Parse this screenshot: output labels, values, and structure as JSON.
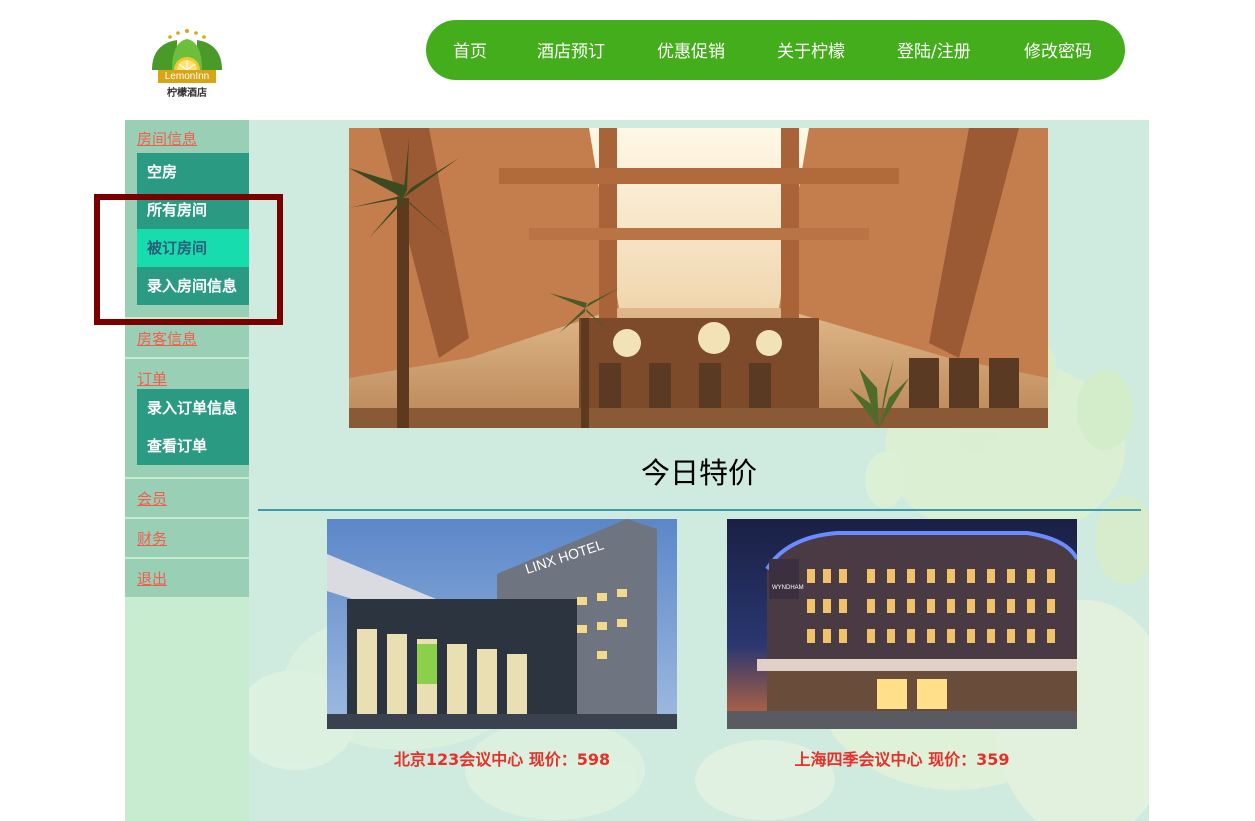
{
  "logo": {
    "brand_text": "LemonInn",
    "cn_text": "柠檬酒店",
    "colors": {
      "green": "#4a9a2a",
      "gold": "#d7a516"
    }
  },
  "topnav": {
    "items": [
      {
        "label": "首页"
      },
      {
        "label": "酒店预订"
      },
      {
        "label": "优惠促销"
      },
      {
        "label": "关于柠檬"
      },
      {
        "label": "登陆/注册"
      },
      {
        "label": "修改密码"
      }
    ],
    "bg_color": "#44ad1b"
  },
  "sidebar": {
    "sections": [
      {
        "label": "房间信息",
        "items": [
          {
            "label": "空房"
          },
          {
            "label": "所有房间"
          },
          {
            "label": "被订房间",
            "active": true
          },
          {
            "label": "录入房间信息"
          }
        ]
      },
      {
        "label": "房客信息",
        "items": []
      },
      {
        "label": "订单",
        "items": [
          {
            "label": "录入订单信息"
          },
          {
            "label": "查看订单"
          }
        ]
      },
      {
        "label": "会员",
        "items": []
      },
      {
        "label": "财务",
        "items": []
      },
      {
        "label": "退出",
        "items": []
      }
    ],
    "link_color": "#f45d4b",
    "sub_bg_color": "#2a9a82",
    "active_bg_color": "#16dcae"
  },
  "main": {
    "special_title": "今日特价",
    "hotels": [
      {
        "caption": "北京123会议中心 现价：598",
        "sign": "LINX HOTEL"
      },
      {
        "caption": "上海四季会议中心 现价：359",
        "sign": "WYNDHAM"
      }
    ],
    "caption_color": "#e8302a"
  }
}
